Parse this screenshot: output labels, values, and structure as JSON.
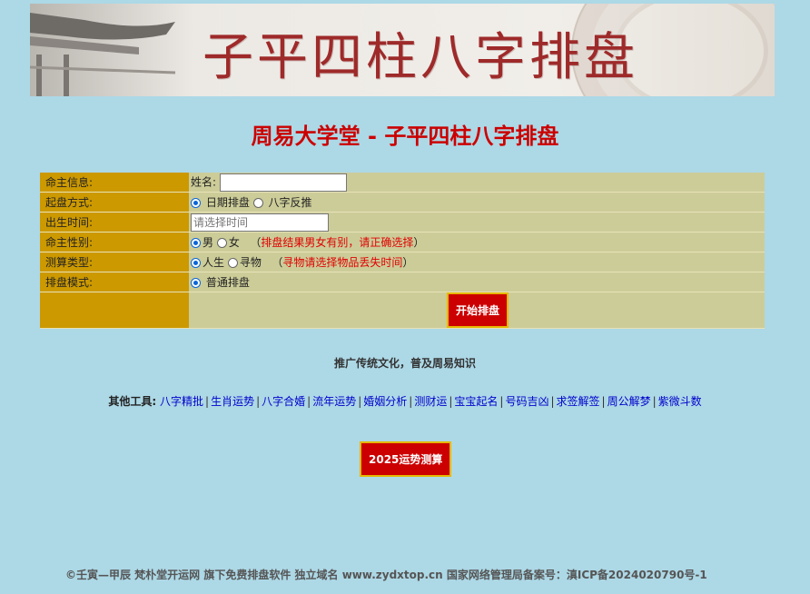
{
  "banner": {
    "title": "子平四柱八字排盘"
  },
  "page_title": "周易大学堂 - 子平四柱八字排盘",
  "form": {
    "rows": [
      {
        "label": "命主信息:"
      },
      {
        "label": "起盘方式:"
      },
      {
        "label": "出生时间:"
      },
      {
        "label": "命主性别:"
      },
      {
        "label": "测算类型:"
      },
      {
        "label": "排盘模式:"
      }
    ],
    "name_label": "姓名:",
    "name_value": "",
    "method_options": [
      "日期排盘",
      "八字反推"
    ],
    "method_selected": "日期排盘",
    "birth_placeholder": "请选择时间",
    "gender_options": [
      "男",
      "女"
    ],
    "gender_selected": "男",
    "gender_note_open": "（",
    "gender_note": "排盘结果男女有别，请正确选择",
    "gender_note_close": "）",
    "type_options": [
      "人生",
      "寻物"
    ],
    "type_selected": "人生",
    "type_note_open": "（",
    "type_note": "寻物请选择物品丢失时间",
    "type_note_close": "）",
    "mode_option": "普通排盘",
    "submit_label": "开始排盘"
  },
  "slogan": "推广传统文化，普及周易知识",
  "tools": {
    "label": "其他工具:",
    "links": [
      "八字精批",
      "生肖运势",
      "八字合婚",
      "流年运势",
      "婚姻分析",
      "测财运",
      "宝宝起名",
      "号码吉凶",
      "求签解签",
      "周公解梦",
      "紫微斗数"
    ]
  },
  "cta_label": "2025运势测算",
  "footer": "©壬寅—甲辰 梵朴堂开运网 旗下免费排盘软件 独立域名 www.zydxtop.cn 国家网络管理局备案号：滇ICP备2024020790号-1",
  "colors": {
    "background": "#add8e6",
    "label_cell": "#cc9900",
    "value_cell": "#cccc99",
    "accent_red": "#cc0000",
    "link_blue": "#0000cc"
  }
}
